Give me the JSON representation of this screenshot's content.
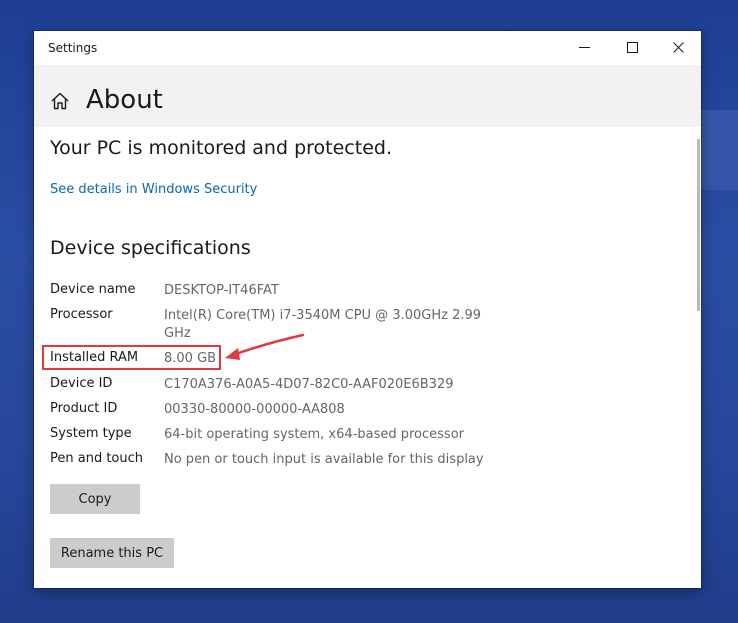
{
  "window": {
    "title": "Settings",
    "controls": {
      "minimize": "minimize-icon",
      "maximize": "maximize-icon",
      "close": "close-icon"
    }
  },
  "page": {
    "icon": "home-icon",
    "title": "About"
  },
  "protection": {
    "text": "Your PC is monitored and protected.",
    "link": "See details in Windows Security"
  },
  "device_specs": {
    "title": "Device specifications",
    "rows": [
      {
        "label": "Device name",
        "value": "DESKTOP-IT46FAT"
      },
      {
        "label": "Processor",
        "value": "Intel(R) Core(TM) i7-3540M CPU @ 3.00GHz   2.99 GHz"
      },
      {
        "label": "Installed RAM",
        "value": "8.00 GB"
      },
      {
        "label": "Device ID",
        "value": "C170A376-A0A5-4D07-82C0-AAF020E6B329"
      },
      {
        "label": "Product ID",
        "value": "00330-80000-00000-AA808"
      },
      {
        "label": "System type",
        "value": "64-bit operating system, x64-based processor"
      },
      {
        "label": "Pen and touch",
        "value": "No pen or touch input is available for this display"
      }
    ]
  },
  "buttons": {
    "copy": "Copy",
    "rename": "Rename this PC"
  },
  "colors": {
    "highlight": "#e0393e",
    "link": "#0a67b0"
  }
}
